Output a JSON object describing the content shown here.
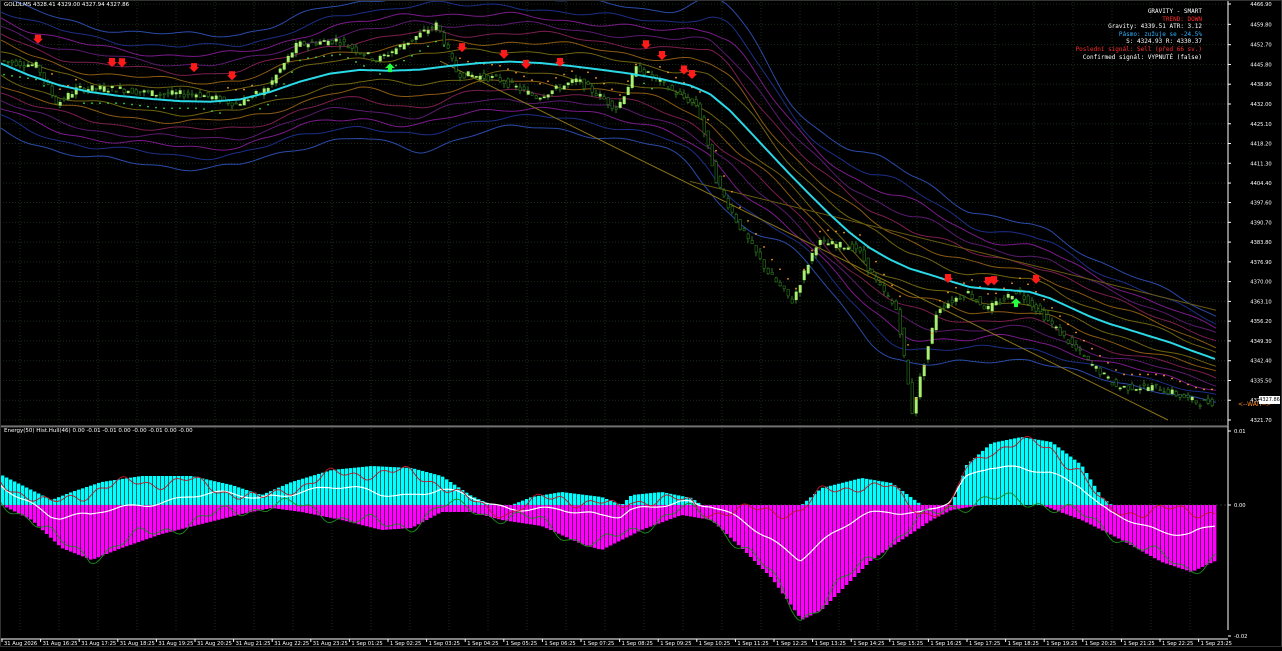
{
  "window": {
    "symbol_line": "GOLDLMS  4328.41 4329.00 4327.94 4327.86",
    "subwindow_line": "Energy(50) Hist.Hull(46) 0.00 -0.01 -0.01 0.00 -0.00 -0.01 0.00 -0.00"
  },
  "info_panel": {
    "title": "GRAVITY - SMART",
    "trend": "TREND: DOWN",
    "gravity": "Gravity: 4339.51   ATR: 3.12",
    "band": "Pásmo: zužuje se -24.5%",
    "sr": "S: 4324.93   R: 4330.37",
    "last_signal": "Poslední signál: Sell (před 66 sv.)",
    "confirmed": "Confirmed signál: VYPNUTÉ (false)"
  },
  "colors": {
    "background": "#000000",
    "grid": "#1a2a1a",
    "gravity_line": "#2ad8e6",
    "candle": "#a8f070",
    "candle_dark": "#2d7a1e",
    "hist_pos": "#00ffff",
    "hist_neg": "#ff00ff",
    "arrow_sell": "#ff1a1a",
    "arrow_buy": "#22ff44",
    "info_title": "#ffffff",
    "info_trend": "#ff2a2a",
    "info_band": "#2ab4ff",
    "info_signal": "#ff2a2a",
    "wait_label": "#ff8c2a"
  },
  "price_axis": [
    "4466.90",
    "4459.80",
    "4452.70",
    "4445.80",
    "4438.90",
    "4432.00",
    "4425.10",
    "4418.20",
    "4411.30",
    "4404.40",
    "4397.60",
    "4390.70",
    "4383.80",
    "4376.90",
    "4370.00",
    "4363.10",
    "4356.20",
    "4349.30",
    "4342.40",
    "4335.50",
    "4328.60",
    "4321.70"
  ],
  "current_price_label": "4327.86",
  "wait_label": "<--WAIT-->",
  "sub_axis": [
    "0.01",
    "0.00",
    "-0.02"
  ],
  "time_axis": [
    "31 Aug 2026",
    "31 Aug 16:25",
    "31 Aug 17:25",
    "31 Aug 18:25",
    "31 Aug 19:25",
    "31 Aug 20:25",
    "31 Aug 21:25",
    "31 Aug 22:25",
    "31 Aug 23:25",
    "1 Sep 01:25",
    "1 Sep 02:25",
    "1 Sep 03:25",
    "1 Sep 04:25",
    "1 Sep 05:25",
    "1 Sep 06:25",
    "1 Sep 07:25",
    "1 Sep 08:25",
    "1 Sep 09:25",
    "1 Sep 10:25",
    "1 Sep 11:25",
    "1 Sep 12:25",
    "1 Sep 13:25",
    "1 Sep 14:25",
    "1 Sep 15:25",
    "1 Sep 16:25",
    "1 Sep 17:25",
    "1 Sep 18:25",
    "1 Sep 19:25",
    "1 Sep 20:25",
    "1 Sep 21:25",
    "1 Sep 22:25",
    "1 Sep 23:25"
  ],
  "chart_data": {
    "type": "line",
    "title": "GRAVITY - SMART",
    "price_range": [
      4321.7,
      4466.9
    ],
    "gravity_line": [
      [
        0,
        4446.3
      ],
      [
        30,
        4441.9
      ],
      [
        60,
        4438.5
      ],
      [
        90,
        4436.2
      ],
      [
        120,
        4434.8
      ],
      [
        150,
        4433.8
      ],
      [
        180,
        4433.0
      ],
      [
        210,
        4432.8
      ],
      [
        240,
        4433.6
      ],
      [
        270,
        4436.2
      ],
      [
        300,
        4439.8
      ],
      [
        330,
        4442.6
      ],
      [
        360,
        4443.9
      ],
      [
        390,
        4443.6
      ],
      [
        420,
        4444.0
      ],
      [
        450,
        4445.3
      ],
      [
        480,
        4446.3
      ],
      [
        510,
        4446.8
      ],
      [
        540,
        4446.3
      ],
      [
        570,
        4445.3
      ],
      [
        600,
        4444.0
      ],
      [
        630,
        4442.6
      ],
      [
        660,
        4440.8
      ],
      [
        690,
        4438.5
      ],
      [
        710,
        4435.5
      ],
      [
        730,
        4429.7
      ],
      [
        750,
        4422.3
      ],
      [
        770,
        4414.8
      ],
      [
        790,
        4407.4
      ],
      [
        810,
        4400.3
      ],
      [
        830,
        4393.4
      ],
      [
        850,
        4387.0
      ],
      [
        870,
        4381.7
      ],
      [
        890,
        4377.7
      ],
      [
        910,
        4374.5
      ],
      [
        930,
        4372.4
      ],
      [
        950,
        4370.2
      ],
      [
        970,
        4368.1
      ],
      [
        990,
        4367.4
      ],
      [
        1010,
        4367.0
      ],
      [
        1030,
        4366.4
      ],
      [
        1050,
        4364.2
      ],
      [
        1070,
        4361.0
      ],
      [
        1090,
        4357.8
      ],
      [
        1110,
        4355.2
      ],
      [
        1130,
        4353.1
      ],
      [
        1150,
        4350.9
      ],
      [
        1170,
        4348.8
      ],
      [
        1190,
        4346.1
      ],
      [
        1216,
        4342.9
      ]
    ],
    "price_samples": [
      [
        2,
        4447.3
      ],
      [
        40,
        4445.3
      ],
      [
        60,
        4432.0
      ],
      [
        80,
        4437.3
      ],
      [
        120,
        4437.3
      ],
      [
        160,
        4435.5
      ],
      [
        200,
        4435.5
      ],
      [
        240,
        4432.0
      ],
      [
        270,
        4437.3
      ],
      [
        300,
        4452.7
      ],
      [
        340,
        4454.3
      ],
      [
        380,
        4447.3
      ],
      [
        420,
        4455.7
      ],
      [
        440,
        4459.8
      ],
      [
        460,
        4442.6
      ],
      [
        500,
        4440.8
      ],
      [
        540,
        4434.4
      ],
      [
        580,
        4440.3
      ],
      [
        620,
        4430.4
      ],
      [
        640,
        4444.9
      ],
      [
        680,
        4435.5
      ],
      [
        700,
        4431.5
      ],
      [
        720,
        4404.4
      ],
      [
        740,
        4390.7
      ],
      [
        770,
        4373.6
      ],
      [
        795,
        4363.1
      ],
      [
        820,
        4383.8
      ],
      [
        860,
        4381.7
      ],
      [
        880,
        4369.4
      ],
      [
        900,
        4359.9
      ],
      [
        915,
        4324.6
      ],
      [
        940,
        4360.3
      ],
      [
        970,
        4366.4
      ],
      [
        990,
        4360.3
      ],
      [
        1020,
        4366.9
      ],
      [
        1040,
        4360.3
      ],
      [
        1060,
        4353.1
      ],
      [
        1090,
        4342.4
      ],
      [
        1120,
        4333.1
      ],
      [
        1160,
        4333.1
      ],
      [
        1200,
        4327.9
      ]
    ],
    "sell_signal_count": 17,
    "buy_signal_count": 2,
    "subwindow": {
      "name": "Energy(50) Hist.Hull(46)",
      "range": [
        -0.02,
        0.01
      ],
      "zero_level": 0.0
    }
  }
}
